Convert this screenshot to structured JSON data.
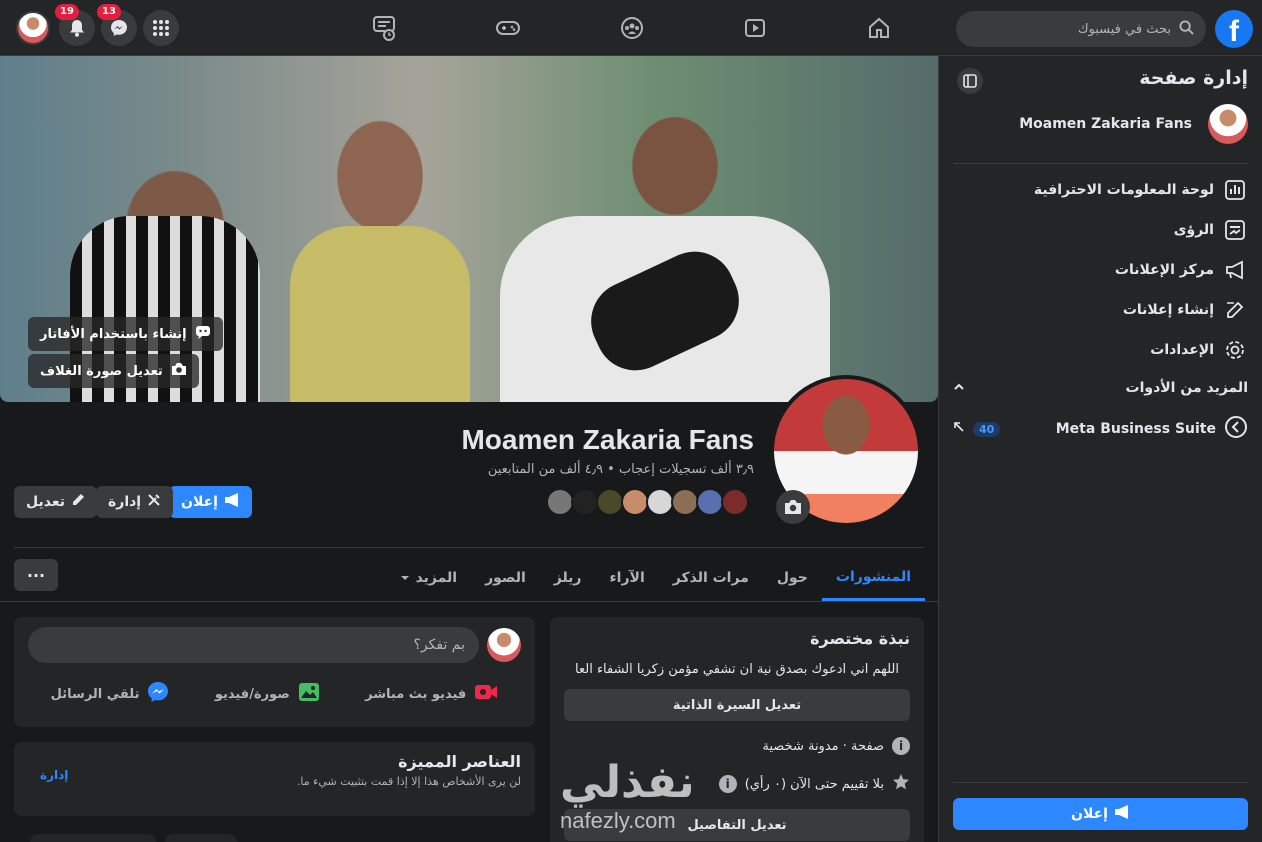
{
  "topbar": {
    "search_placeholder": "بحث في فيسبوك",
    "notifications_count": "19",
    "messenger_count": "13",
    "nav": [
      "home-icon",
      "watch-icon",
      "groups-icon",
      "gaming-icon",
      "feeds-icon"
    ]
  },
  "sidebar": {
    "title": "إدارة صفحة",
    "page_name": "Moamen Zakaria Fans",
    "items": [
      {
        "label": "لوحة المعلومات الاحترافية",
        "icon": "dashboard-icon"
      },
      {
        "label": "الرؤى",
        "icon": "insights-icon"
      },
      {
        "label": "مركز الإعلانات",
        "icon": "megaphone-icon"
      },
      {
        "label": "إنشاء إعلانات",
        "icon": "edit-icon"
      },
      {
        "label": "الإعدادات",
        "icon": "gear-icon"
      }
    ],
    "more_tools": "المزيد من الأدوات",
    "meta_suite": "Meta Business Suite",
    "meta_badge": "40",
    "promote": "إعلان"
  },
  "cover": {
    "avatar_btn": "إنشاء باستخدام الأفاتار",
    "edit_cover_btn": "تعديل صورة الغلاف"
  },
  "profile": {
    "name": "Moamen Zakaria Fans",
    "stats": "٣٫٩ ألف تسجيلات إعجاب • ٤٫٩ ألف من المتابعين"
  },
  "actions": {
    "promote": "إعلان",
    "manage": "إدارة",
    "edit": "تعديل"
  },
  "tabs": [
    "المنشورات",
    "حول",
    "مرات الذكر",
    "الآراء",
    "ريلز",
    "الصور",
    "المزيد"
  ],
  "intro": {
    "title": "نبذة مختصرة",
    "bio": "اللهم اني ادعوك بصدق نية ان تشفي مؤمن زكريا الشفاء العا",
    "edit_bio": "تعديل السيرة الذاتية",
    "category": "صفحة · مدونة شخصية",
    "rating": "بلا تقييم حتى الآن (٠ رأي)",
    "edit_details": "تعديل التفاصيل"
  },
  "composer": {
    "placeholder": "بم تفكر؟",
    "live": "فيديو بث مباشر",
    "photo": "صورة/فيديو",
    "messages": "تلقي الرسائل"
  },
  "featured": {
    "title": "العناصر المميزة",
    "desc": "لن يرى الأشخاص هذا إلا إذا قمت بتثبيت شيء ما.",
    "manage": "إدارة"
  },
  "watermark": {
    "arabic": "نفذلي",
    "latin": "nafezly.com"
  },
  "colors": {
    "accent": "#2d88ff",
    "background": "#18191a",
    "surface": "#242526",
    "badge": "#e41e3f"
  }
}
